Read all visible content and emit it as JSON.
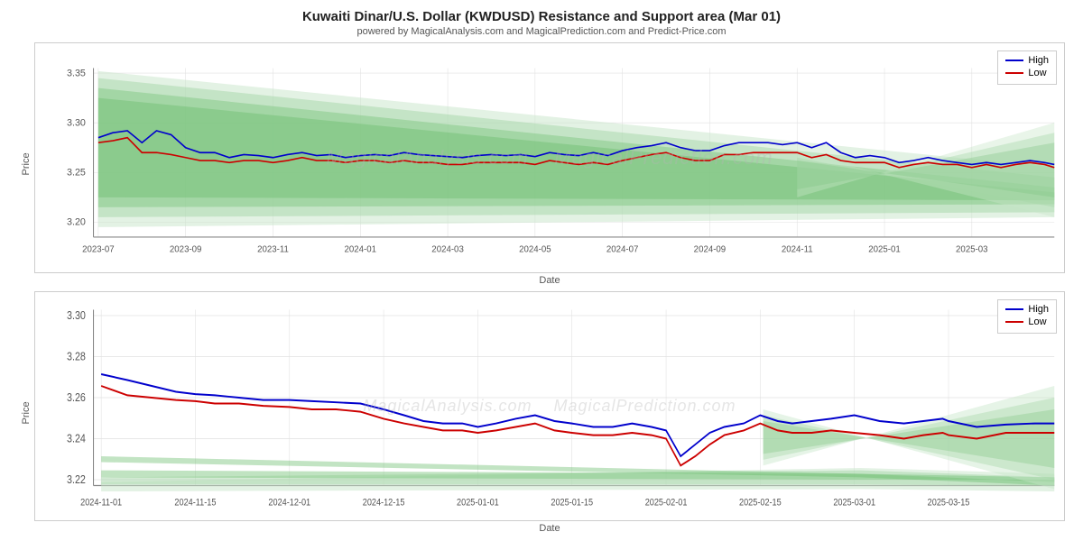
{
  "title": "Kuwaiti Dinar/U.S. Dollar (KWDUSD) Resistance and Support area (Mar 01)",
  "subtitle": "powered by MagicalAnalysis.com and MagicalPrediction.com and Predict-Price.com",
  "chart1": {
    "y_label": "Price",
    "x_label": "Date",
    "y_ticks": [
      "3.35",
      "3.30",
      "3.25"
    ],
    "x_ticks": [
      "2023-07",
      "2023-09",
      "2023-11",
      "2024-01",
      "2024-03",
      "2024-05",
      "2024-07",
      "2024-09",
      "2024-11",
      "2025-01",
      "2025-03"
    ],
    "legend": {
      "high_label": "High",
      "low_label": "Low",
      "high_color": "#0000cc",
      "low_color": "#cc0000"
    }
  },
  "chart2": {
    "y_label": "Price",
    "x_label": "Date",
    "y_ticks": [
      "3.30",
      "3.28",
      "3.26",
      "3.24"
    ],
    "x_ticks": [
      "2024-11-01",
      "2024-11-15",
      "2024-12-01",
      "2024-12-15",
      "2025-01-01",
      "2025-01-15",
      "2025-02-01",
      "2025-02-15",
      "2025-03-01",
      "2025-03-15"
    ],
    "legend": {
      "high_label": "High",
      "low_label": "Low",
      "high_color": "#0000cc",
      "low_color": "#cc0000"
    }
  }
}
